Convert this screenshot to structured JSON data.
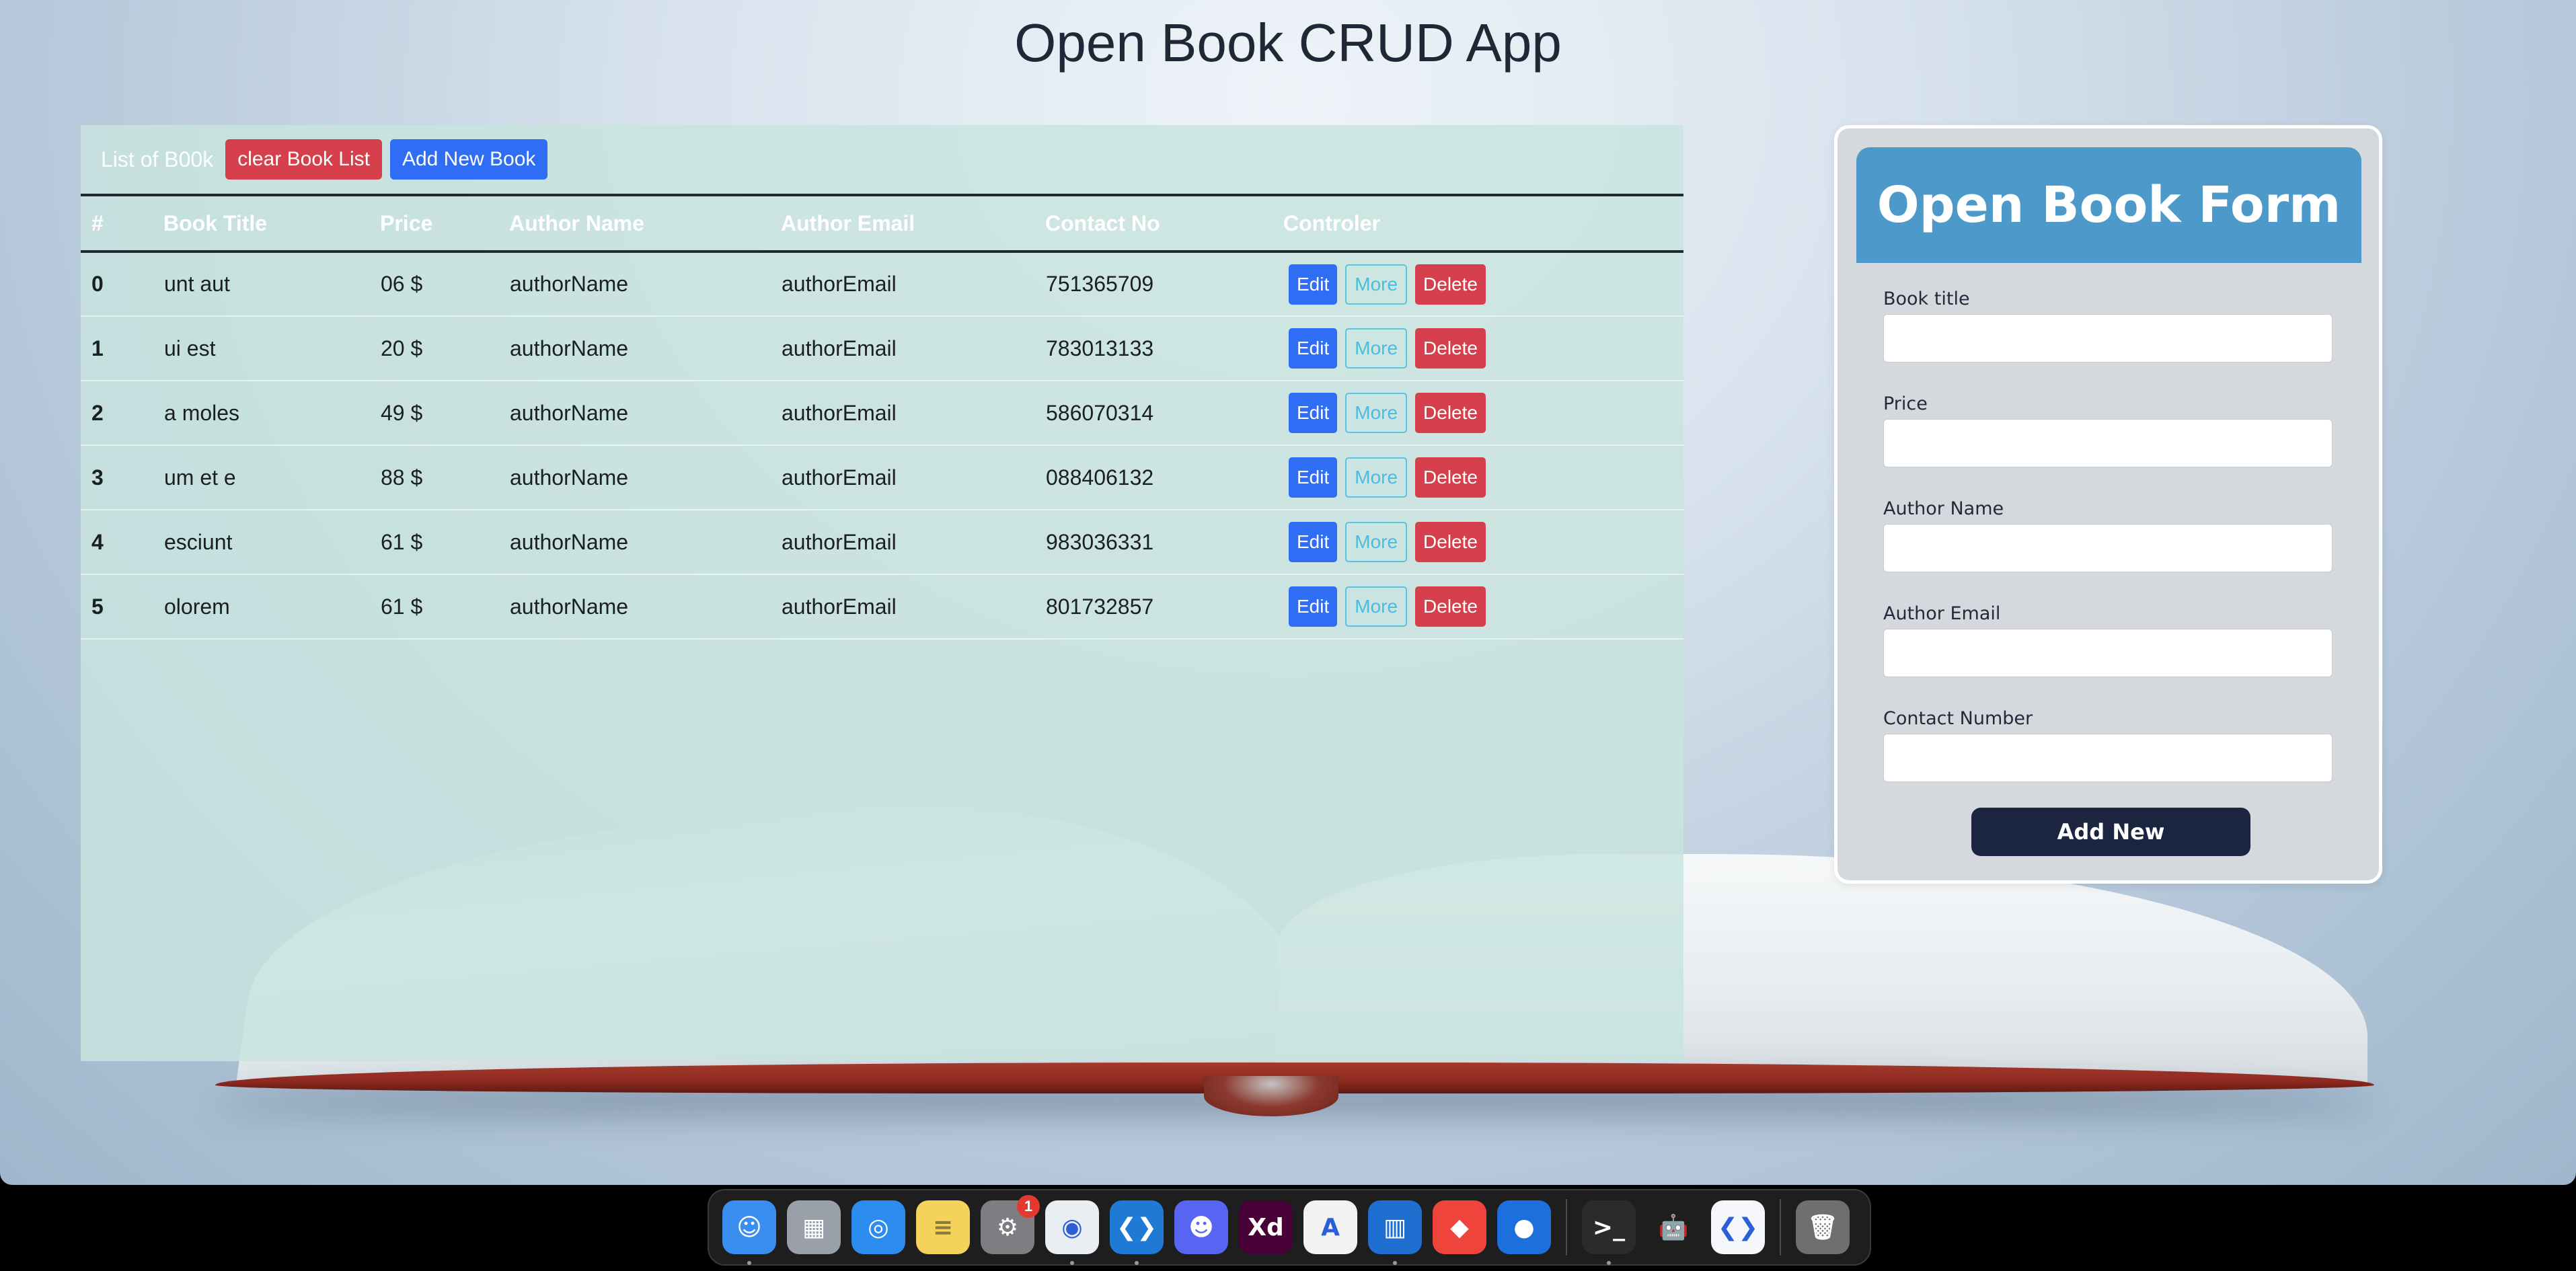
{
  "app": {
    "title": "Open Book CRUD App"
  },
  "table_panel": {
    "toolbar_label": "List of B00k",
    "clear_label": "clear Book List",
    "add_label": "Add New Book"
  },
  "table": {
    "headers": [
      "#",
      "Book Title",
      "Price",
      "Author Name",
      "Author Email",
      "Contact No",
      "Controler"
    ],
    "rows": [
      {
        "idx": "0",
        "title": "unt aut",
        "price": "06 $",
        "author": "authorName",
        "email": "authorEmail",
        "contact": "751365709"
      },
      {
        "idx": "1",
        "title": "ui est",
        "price": "20 $",
        "author": "authorName",
        "email": "authorEmail",
        "contact": "783013133"
      },
      {
        "idx": "2",
        "title": "a moles",
        "price": "49 $",
        "author": "authorName",
        "email": "authorEmail",
        "contact": "586070314"
      },
      {
        "idx": "3",
        "title": "um et e",
        "price": "88 $",
        "author": "authorName",
        "email": "authorEmail",
        "contact": "088406132"
      },
      {
        "idx": "4",
        "title": "esciunt",
        "price": "61 $",
        "author": "authorName",
        "email": "authorEmail",
        "contact": "983036331"
      },
      {
        "idx": "5",
        "title": "olorem",
        "price": "61 $",
        "author": "authorName",
        "email": "authorEmail",
        "contact": "801732857"
      }
    ],
    "row_buttons": {
      "edit": "Edit",
      "more": "More",
      "delete": "Delete"
    }
  },
  "form": {
    "title": "Open Book Form",
    "fields": [
      {
        "label": "Book title",
        "value": ""
      },
      {
        "label": "Price",
        "value": ""
      },
      {
        "label": "Author Name",
        "value": ""
      },
      {
        "label": "Author Email",
        "value": ""
      },
      {
        "label": "Contact Number",
        "value": ""
      }
    ],
    "submit_label": "Add New"
  },
  "dock": {
    "items": [
      {
        "name": "finder-icon",
        "color": "#3a8ef0",
        "glyph": "☺",
        "running": true
      },
      {
        "name": "launchpad-icon",
        "color": "#9aa0aa",
        "glyph": "▦",
        "running": false
      },
      {
        "name": "safari-icon",
        "color": "#2d8cf0",
        "glyph": "◎",
        "running": false
      },
      {
        "name": "notes-icon",
        "color": "#f5d35a",
        "glyph": "≡",
        "running": false
      },
      {
        "name": "system-settings-icon",
        "color": "#7d7d82",
        "glyph": "⚙",
        "running": false,
        "badge": "1"
      },
      {
        "name": "chrome-icon",
        "color": "#e9eef3",
        "glyph": "◉",
        "running": true
      },
      {
        "name": "vscode-icon",
        "color": "#1f7ad6",
        "glyph": "❮❯",
        "running": true
      },
      {
        "name": "discord-icon",
        "color": "#5865f2",
        "glyph": "☻",
        "running": false
      },
      {
        "name": "adobe-xd-icon",
        "color": "#470137",
        "glyph": "Xd",
        "running": false
      },
      {
        "name": "android-studio-icon",
        "color": "#f2f2f2",
        "glyph": "A",
        "running": false
      },
      {
        "name": "trello-icon",
        "color": "#1f6fd0",
        "glyph": "▥",
        "running": true
      },
      {
        "name": "anydesk-icon",
        "color": "#ef443b",
        "glyph": "◆",
        "running": false
      },
      {
        "name": "sourcetree-icon",
        "color": "#1d6fde",
        "glyph": "●",
        "running": false
      },
      {
        "separator": true
      },
      {
        "name": "terminal-icon",
        "color": "#2b2b2b",
        "glyph": ">_",
        "running": true
      },
      {
        "name": "android-icon",
        "color": "#1e1e1e",
        "glyph": "🤖",
        "running": false
      },
      {
        "name": "vscode-insiders-icon",
        "color": "#f5f7fa",
        "glyph": "❮❯",
        "running": false
      },
      {
        "separator": true
      },
      {
        "name": "trash-icon",
        "color": "#6f6f6f",
        "glyph": "🗑",
        "running": false
      }
    ]
  },
  "colors": {
    "accent_blue": "#2f6df5",
    "danger_red": "#d5404c",
    "info_cyan": "#48bde0",
    "form_header": "#4d99c9",
    "submit_dark": "#1b2540"
  }
}
